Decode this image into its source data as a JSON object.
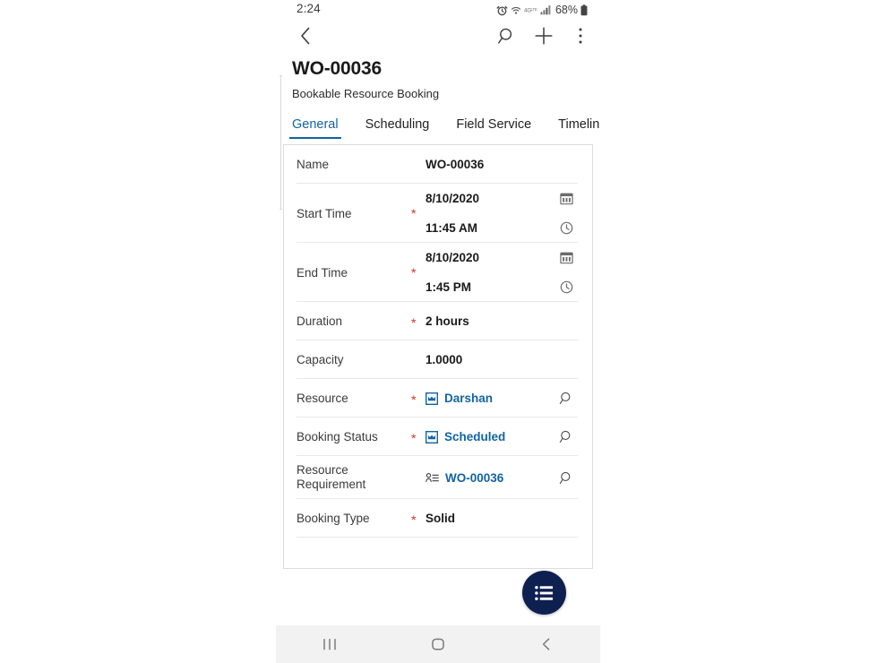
{
  "status_bar": {
    "clock": "2:24",
    "battery_text": "68%",
    "icons": [
      "alarm-icon",
      "wifi-icon",
      "4g-lte-icon",
      "signal-bars-icon",
      "battery-icon"
    ]
  },
  "app_bar": {
    "back_icon": "chevron-left-icon",
    "actions": [
      {
        "icon": "search-icon",
        "name": "search-button"
      },
      {
        "icon": "plus-icon",
        "name": "new-record-button"
      },
      {
        "icon": "more-vertical-icon",
        "name": "overflow-menu-button"
      }
    ]
  },
  "record": {
    "title": "WO-00036",
    "subtitle": "Bookable Resource Booking"
  },
  "tabs": [
    {
      "label": "General",
      "active": true
    },
    {
      "label": "Scheduling",
      "active": false
    },
    {
      "label": "Field Service",
      "active": false
    },
    {
      "label": "Timeline",
      "active": false
    }
  ],
  "form": {
    "name": {
      "label": "Name",
      "value": "WO-00036"
    },
    "start_time": {
      "label": "Start Time",
      "required": "*",
      "date": "8/10/2020",
      "time": "11:45 AM",
      "date_icon": "calendar-icon",
      "time_icon": "clock-icon"
    },
    "end_time": {
      "label": "End Time",
      "required": "*",
      "date": "8/10/2020",
      "time": "1:45 PM",
      "date_icon": "calendar-icon",
      "time_icon": "clock-icon"
    },
    "duration": {
      "label": "Duration",
      "required": "*",
      "value": "2 hours"
    },
    "capacity": {
      "label": "Capacity",
      "value": "1.0000"
    },
    "resource": {
      "label": "Resource",
      "required": "*",
      "value": "Darshan",
      "entity_icon": "bookable-resource-entity-icon",
      "lookup_icon": "search-icon"
    },
    "booking_status": {
      "label": "Booking Status",
      "required": "*",
      "value": "Scheduled",
      "entity_icon": "booking-status-entity-icon",
      "lookup_icon": "search-icon"
    },
    "resource_requirement": {
      "label": "Resource Requirement",
      "value": "WO-00036",
      "entity_icon": "resource-requirement-entity-icon",
      "lookup_icon": "search-icon"
    },
    "booking_type": {
      "label": "Booking Type",
      "required": "*",
      "value": "Solid"
    }
  },
  "fab": {
    "icon": "list-menu-icon",
    "color": "#0e2050"
  },
  "nav_bar": {
    "recents_icon": "recents-icon",
    "home_icon": "home-icon",
    "back_icon": "back-icon"
  },
  "colors": {
    "accent_blue": "#1264a3",
    "required_red": "#d93025",
    "fab_navy": "#0e2050",
    "divider": "#e8e8e8",
    "card_border": "#dcdcdc"
  }
}
